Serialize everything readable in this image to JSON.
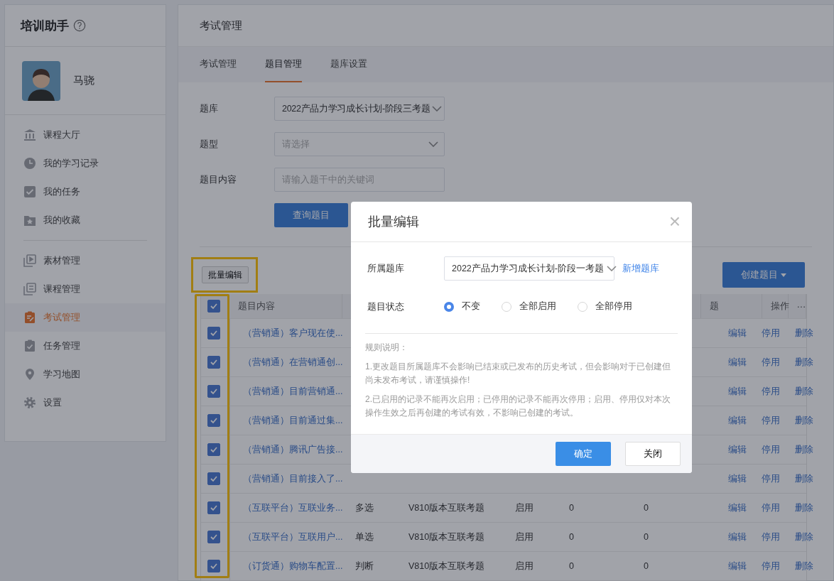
{
  "sidebar": {
    "title": "培训助手",
    "user": {
      "name": "马骁"
    },
    "groups": [
      [
        {
          "label": "课程大厅",
          "kind": "bank",
          "selected": false
        },
        {
          "label": "我的学习记录",
          "kind": "clock",
          "selected": false
        },
        {
          "label": "我的任务",
          "kind": "check",
          "selected": false
        },
        {
          "label": "我的收藏",
          "kind": "star",
          "selected": false
        }
      ],
      [
        {
          "label": "素材管理",
          "kind": "play",
          "selected": false
        },
        {
          "label": "课程管理",
          "kind": "list",
          "selected": false
        },
        {
          "label": "考试管理",
          "kind": "clip-edit",
          "selected": true
        },
        {
          "label": "任务管理",
          "kind": "clip-check",
          "selected": false
        },
        {
          "label": "学习地图",
          "kind": "pin",
          "selected": false
        },
        {
          "label": "设置",
          "kind": "gear",
          "selected": false
        }
      ]
    ]
  },
  "page": {
    "title": "考试管理",
    "tabs": [
      {
        "label": "考试管理",
        "selected": false
      },
      {
        "label": "题目管理",
        "selected": true
      },
      {
        "label": "题库设置",
        "selected": false
      }
    ],
    "filters": [
      {
        "label": "题库",
        "kind": "select",
        "value": "2022产品力学习成长计划-阶段三考题"
      },
      {
        "label": "题型",
        "kind": "select",
        "placeholder": "请选择"
      },
      {
        "label": "题目内容",
        "kind": "input",
        "placeholder": "请输入题干中的关键词"
      }
    ],
    "query_button": "查询题目",
    "batch_button": {
      "label": "批量编辑",
      "highlighted": true
    },
    "create_button": "创建题目"
  },
  "table": {
    "checkbox_column_highlighted": true,
    "all_checked": true,
    "columns": [
      {
        "label": "题目内容"
      },
      {},
      {},
      {},
      {},
      {},
      {
        "label": "题"
      },
      {
        "label": "操作"
      },
      {
        "label": "⋯"
      }
    ],
    "rows": [
      {
        "checked": true,
        "content": "（营销通）客户现在使...",
        "actions": [
          "编辑",
          "停用",
          "删除"
        ]
      },
      {
        "checked": true,
        "content": "（营销通）在营销通创...",
        "actions": [
          "编辑",
          "停用",
          "删除"
        ]
      },
      {
        "checked": true,
        "content": "（营销通）目前营销通...",
        "actions": [
          "编辑",
          "停用",
          "删除"
        ]
      },
      {
        "checked": true,
        "content": "（营销通）目前通过集...",
        "actions": [
          "编辑",
          "停用",
          "删除"
        ]
      },
      {
        "checked": true,
        "content": "（营销通）腾讯广告接...",
        "actions": [
          "编辑",
          "停用",
          "删除"
        ]
      },
      {
        "checked": true,
        "content": "（营销通）目前接入了...",
        "actions": [
          "编辑",
          "停用",
          "删除"
        ]
      },
      {
        "checked": true,
        "content": "（互联平台）互联业务...",
        "type": "多选",
        "bank": "V810版本互联考题",
        "status": "启用",
        "column_5": "0",
        "column_6": "0",
        "actions": [
          "编辑",
          "停用",
          "删除"
        ]
      },
      {
        "checked": true,
        "content": "（互联平台）互联用户...",
        "type": "单选",
        "bank": "V810版本互联考题",
        "status": "启用",
        "column_5": "0",
        "column_6": "0",
        "actions": [
          "编辑",
          "停用",
          "删除"
        ]
      },
      {
        "checked": true,
        "content": "（订货通）购物车配置...",
        "type": "判断",
        "bank": "V810版本互联考题",
        "status": "启用",
        "column_5": "0",
        "column_6": "0",
        "actions": [
          "编辑",
          "停用",
          "删除"
        ]
      }
    ]
  },
  "dialog": {
    "title": "批量编辑",
    "close": "×",
    "bank_label": "所属题库",
    "bank_value": "2022产品力学习成长计划-阶段一考题",
    "add_bank_link": "新增题库",
    "status_label": "题目状态",
    "status_options": [
      {
        "label": "不变",
        "selected": true
      },
      {
        "label": "全部启用",
        "selected": false
      },
      {
        "label": "全部停用",
        "selected": false
      }
    ],
    "rules_title": "规则说明：",
    "rules": [
      "1.更改题目所属题库不会影响已结束或已发布的历史考试，但会影响对于已创建但尚未发布考试，请谨慎操作!",
      "2.已启用的记录不能再次启用；已停用的记录不能再次停用；启用、停用仅对本次操作生效之后再创建的考试有效，不影响已创建的考试。"
    ],
    "confirm": "确定",
    "cancel": "关闭"
  }
}
